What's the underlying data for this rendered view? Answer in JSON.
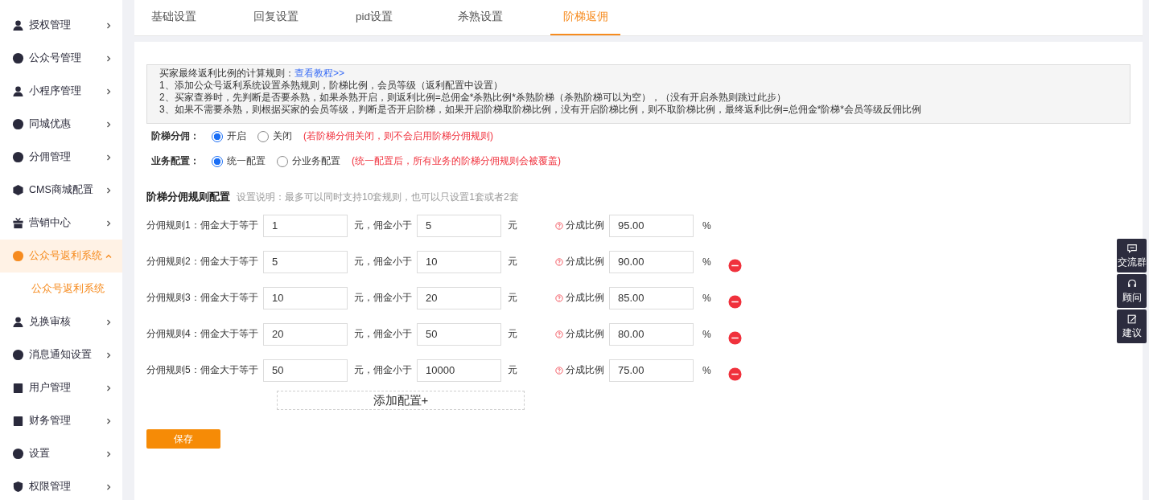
{
  "sidebar": {
    "items": [
      {
        "label": "授权管理",
        "expanded": false,
        "selected": false
      },
      {
        "label": "公众号管理",
        "expanded": false,
        "selected": false
      },
      {
        "label": "小程序管理",
        "expanded": false,
        "selected": false
      },
      {
        "label": "同城优惠",
        "expanded": false,
        "selected": false
      },
      {
        "label": "分佣管理",
        "expanded": false,
        "selected": false
      },
      {
        "label": "CMS商城配置",
        "expanded": false,
        "selected": false
      },
      {
        "label": "营销中心",
        "expanded": false,
        "selected": false
      },
      {
        "label": "公众号返利系统",
        "expanded": true,
        "selected": true,
        "children": [
          {
            "label": "公众号返利系统",
            "selected": true
          }
        ]
      },
      {
        "label": "兑换审核",
        "expanded": false,
        "selected": false
      },
      {
        "label": "消息通知设置",
        "expanded": false,
        "selected": false
      },
      {
        "label": "用户管理",
        "expanded": false,
        "selected": false
      },
      {
        "label": "财务管理",
        "expanded": false,
        "selected": false
      },
      {
        "label": "设置",
        "expanded": false,
        "selected": false
      },
      {
        "label": "权限管理",
        "expanded": false,
        "selected": false
      }
    ]
  },
  "tabs": [
    {
      "label": "基础设置",
      "selected": false
    },
    {
      "label": "回复设置",
      "selected": false
    },
    {
      "label": "pid设置",
      "selected": false
    },
    {
      "label": "杀熟设置",
      "selected": false
    },
    {
      "label": "阶梯返佣",
      "selected": true
    }
  ],
  "notice": {
    "title": "买家最终返利比例的计算规则：",
    "link": "查看教程>>",
    "lines": [
      "1、添加公众号返利系统设置杀熟规则，阶梯比例，会员等级（返利配置中设置）",
      "2、买家查券时，先判断是否要杀熟，如果杀熟开启，则返利比例=总佣金*杀熟比例*杀熟阶梯（杀熟阶梯可以为空），（没有开启杀熟则跳过此步）",
      "3、如果不需要杀熟，则根据买家的会员等级，判断是否开启阶梯，如果开启阶梯取阶梯比例，没有开启阶梯比例，则不取阶梯比例，最终返利比例=总佣金*阶梯*会员等级反佣比例"
    ]
  },
  "settings": [
    {
      "label": "阶梯分佣：",
      "options": [
        {
          "label": "开启",
          "selected": true
        },
        {
          "label": "关闭",
          "selected": false
        }
      ],
      "hint": "(若阶梯分佣关闭，则不会启用阶梯分佣规则)"
    },
    {
      "label": "业务配置：",
      "options": [
        {
          "label": "统一配置",
          "selected": true
        },
        {
          "label": "分业务配置",
          "selected": false
        }
      ],
      "hint": "(统一配置后，所有业务的阶梯分佣规则会被覆盖)"
    }
  ],
  "rules_section": {
    "title": "阶梯分佣规则配置",
    "description": "设置说明：最多可以同时支持10套规则，也可以只设置1套或者2套"
  },
  "rules": [
    {
      "label": "分佣规则1：",
      "min_label": "佣金大于等于",
      "min": "1",
      "max_label": "元，佣金小于",
      "max": "5",
      "unit": "元",
      "ratio_label": "分成比例",
      "ratio": "95.00",
      "percent": "%",
      "removable": false
    },
    {
      "label": "分佣规则2：",
      "min_label": "佣金大于等于",
      "min": "5",
      "max_label": "元，佣金小于",
      "max": "10",
      "unit": "元",
      "ratio_label": "分成比例",
      "ratio": "90.00",
      "percent": "%",
      "removable": true
    },
    {
      "label": "分佣规则3：",
      "min_label": "佣金大于等于",
      "min": "10",
      "max_label": "元，佣金小于",
      "max": "20",
      "unit": "元",
      "ratio_label": "分成比例",
      "ratio": "85.00",
      "percent": "%",
      "removable": true
    },
    {
      "label": "分佣规则4：",
      "min_label": "佣金大于等于",
      "min": "20",
      "max_label": "元，佣金小于",
      "max": "50",
      "unit": "元",
      "ratio_label": "分成比例",
      "ratio": "80.00",
      "percent": "%",
      "removable": true
    },
    {
      "label": "分佣规则5：",
      "min_label": "佣金大于等于",
      "min": "50",
      "max_label": "元，佣金小于",
      "max": "10000",
      "unit": "元",
      "ratio_label": "分成比例",
      "ratio": "75.00",
      "percent": "%",
      "removable": true
    }
  ],
  "add_button": "添加配置+",
  "save_button": "保存",
  "float_tools": [
    {
      "label": "交流群"
    },
    {
      "label": "顾问"
    },
    {
      "label": "建议"
    }
  ]
}
